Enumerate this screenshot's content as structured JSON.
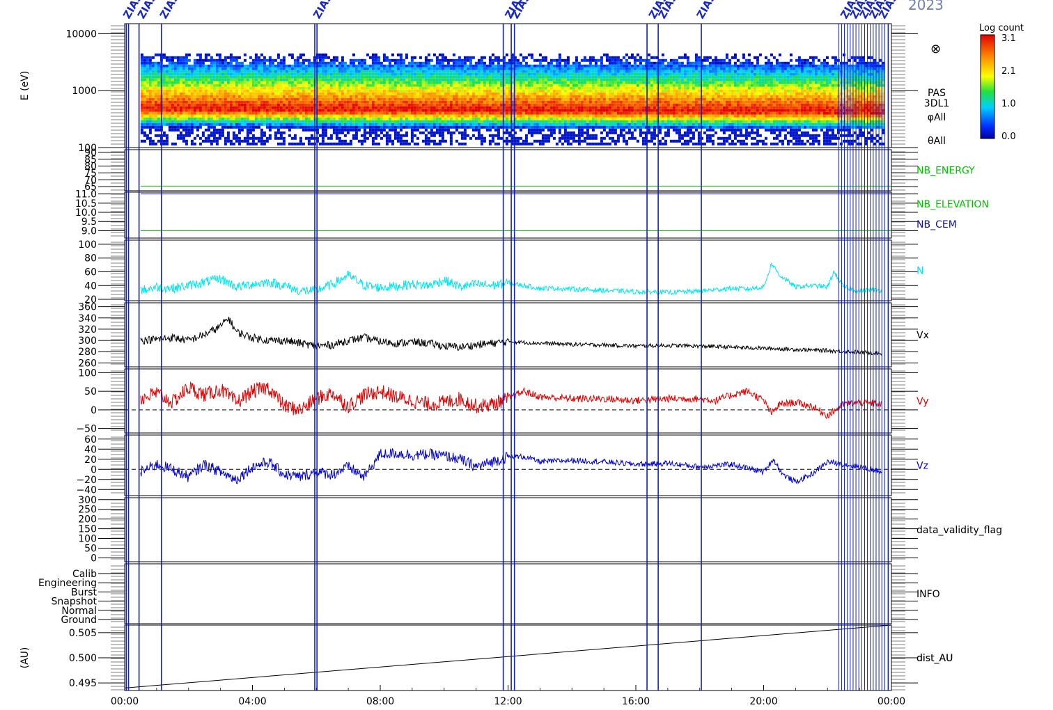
{
  "title_fragment": "2023",
  "colorbar": {
    "title": "Log count",
    "ticks": [
      "3.1",
      "2.1",
      "1.0",
      "0.0"
    ]
  },
  "x_axis": {
    "ticks": [
      "00:00",
      "04:00",
      "08:00",
      "12:00",
      "16:00",
      "20:00",
      "00:00"
    ]
  },
  "event_label": "ZIAS",
  "chart_data": [
    {
      "type": "heatmap",
      "name": "PAS 3DL1",
      "ylabel": "E (eV)",
      "yscale": "log",
      "ylim": [
        100,
        15000
      ],
      "yticks": [
        "10000",
        "1000",
        "100"
      ],
      "side_labels": [
        "PAS",
        "3DL1",
        "φAll",
        "θAll"
      ],
      "x_range_hours": [
        0.5,
        23.7
      ],
      "band": {
        "peak_eV": 500,
        "upper_eV": 4500,
        "lower_eV": 240
      },
      "special_mark": "⊗"
    },
    {
      "type": "line",
      "name": "NB_ENERGY",
      "yticks": [
        "90",
        "85",
        "80",
        "75",
        "70",
        "65"
      ],
      "ylim": [
        62,
        92
      ],
      "series": [
        {
          "name": "NB_ENERGY",
          "color": "#00c000",
          "constant": 65.4
        }
      ]
    },
    {
      "type": "line",
      "yticks": [
        "11.0",
        "10.5",
        "10.0",
        "9.5",
        "9.0"
      ],
      "ylim": [
        8.6,
        11.1
      ],
      "series": [
        {
          "name": "NB_ELEVATION",
          "color": "#00c000",
          "constant": 9.0
        },
        {
          "name": "NB_CEM",
          "color": "#1010a0",
          "constant": 11.0
        }
      ]
    },
    {
      "type": "line",
      "name": "N",
      "color": "#00e5ee",
      "yticks": [
        "100",
        "80",
        "60",
        "40",
        "20"
      ],
      "ylim": [
        18,
        106
      ],
      "x": [
        0.5,
        1,
        1.5,
        2,
        2.5,
        3,
        3.5,
        4,
        4.5,
        5,
        5.5,
        6,
        6.5,
        7,
        7.5,
        8,
        8.5,
        9,
        9.5,
        10,
        10.5,
        11,
        11.5,
        12,
        12.5,
        13,
        13.5,
        14,
        14.5,
        15,
        15.5,
        16,
        16.5,
        17,
        17.5,
        18,
        18.5,
        19,
        19.5,
        20,
        20.25,
        20.5,
        21,
        21.5,
        22,
        22.2,
        22.5,
        23,
        23.3,
        23.7
      ],
      "values": [
        33,
        38,
        36,
        40,
        45,
        50,
        38,
        42,
        45,
        40,
        32,
        33,
        42,
        55,
        40,
        37,
        39,
        42,
        40,
        48,
        38,
        42,
        40,
        44,
        40,
        36,
        36,
        35,
        34,
        33,
        32,
        31,
        31,
        30,
        31,
        32,
        34,
        36,
        35,
        38,
        72,
        55,
        38,
        40,
        38,
        60,
        38,
        32,
        34,
        33
      ]
    },
    {
      "type": "line",
      "name": "Vx",
      "color": "#000000",
      "yticks": [
        "360",
        "340",
        "320",
        "300",
        "280",
        "260"
      ],
      "ylim": [
        253,
        367
      ],
      "x": [
        0.5,
        1,
        1.5,
        2,
        2.5,
        3,
        3.25,
        3.5,
        4,
        4.5,
        5,
        5.5,
        6,
        6.5,
        7,
        7.5,
        8,
        8.5,
        9,
        9.5,
        10,
        10.5,
        11,
        11.5,
        12,
        13,
        14,
        15,
        16,
        17,
        18,
        19,
        20,
        21,
        22,
        23,
        23.7
      ],
      "values": [
        300,
        302,
        305,
        300,
        310,
        325,
        340,
        315,
        305,
        300,
        300,
        295,
        290,
        292,
        300,
        305,
        298,
        295,
        297,
        295,
        290,
        288,
        292,
        295,
        298,
        295,
        293,
        292,
        290,
        291,
        290,
        288,
        286,
        284,
        282,
        279,
        277
      ]
    },
    {
      "type": "line",
      "name": "Vy",
      "color": "#e00000",
      "yticks": [
        "100",
        "50",
        "0",
        "−50"
      ],
      "ylim": [
        -62,
        110
      ],
      "zero_line": true,
      "x": [
        0.5,
        1,
        1.5,
        2,
        2.5,
        3,
        3.5,
        4,
        4.5,
        5,
        5.5,
        6,
        6.5,
        7,
        7.5,
        8,
        8.5,
        9,
        9.5,
        10,
        10.5,
        11,
        11.5,
        12,
        12.5,
        13,
        14,
        15,
        16,
        17,
        18,
        18.5,
        19,
        19.5,
        20,
        20.25,
        20.5,
        21,
        21.5,
        22,
        22.5,
        23,
        23.7
      ],
      "values": [
        30,
        45,
        20,
        60,
        40,
        55,
        20,
        50,
        60,
        10,
        0,
        30,
        45,
        10,
        40,
        50,
        35,
        25,
        15,
        20,
        30,
        10,
        15,
        30,
        50,
        35,
        30,
        30,
        25,
        30,
        30,
        25,
        40,
        50,
        25,
        -10,
        15,
        20,
        10,
        -15,
        15,
        20,
        15
      ]
    },
    {
      "type": "line",
      "name": "Vz",
      "color": "#0000d0",
      "yticks": [
        "60",
        "40",
        "20",
        "0",
        "−20",
        "−40"
      ],
      "ylim": [
        -52,
        68
      ],
      "zero_line": true,
      "x": [
        0.5,
        1,
        1.5,
        2,
        2.5,
        3,
        3.5,
        4,
        4.5,
        5,
        5.5,
        6,
        6.5,
        7,
        7.5,
        8,
        8.5,
        9,
        9.5,
        10,
        10.5,
        11,
        11.5,
        12,
        12.5,
        13,
        14,
        15,
        16,
        17,
        18,
        19,
        20,
        20.3,
        20.6,
        21,
        21.5,
        22,
        22.5,
        23,
        23.7
      ],
      "values": [
        -5,
        10,
        0,
        -15,
        10,
        -5,
        -20,
        5,
        15,
        -10,
        -15,
        -5,
        -10,
        5,
        -15,
        30,
        32,
        28,
        30,
        27,
        20,
        5,
        15,
        25,
        25,
        15,
        18,
        15,
        10,
        12,
        5,
        10,
        -5,
        20,
        -10,
        -25,
        -10,
        15,
        10,
        5,
        -5
      ]
    },
    {
      "type": "line",
      "name": "data_validity_flag",
      "yticks": [
        "300",
        "250",
        "200",
        "150",
        "100",
        "50",
        "0"
      ],
      "ylim": [
        -20,
        310
      ]
    },
    {
      "type": "line",
      "name": "INFO",
      "yticks": [
        "Calib",
        "Engineering",
        "Burst",
        "Snapshot",
        "Normal",
        "Ground"
      ]
    },
    {
      "type": "line",
      "name": "dist_AU",
      "ylabel": "(AU)",
      "color": "#000000",
      "yticks": [
        "0.505",
        "0.500",
        "0.495"
      ],
      "ylim": [
        0.4935,
        0.5065
      ],
      "x": [
        0,
        24
      ],
      "values": [
        0.494,
        0.5065
      ]
    }
  ]
}
